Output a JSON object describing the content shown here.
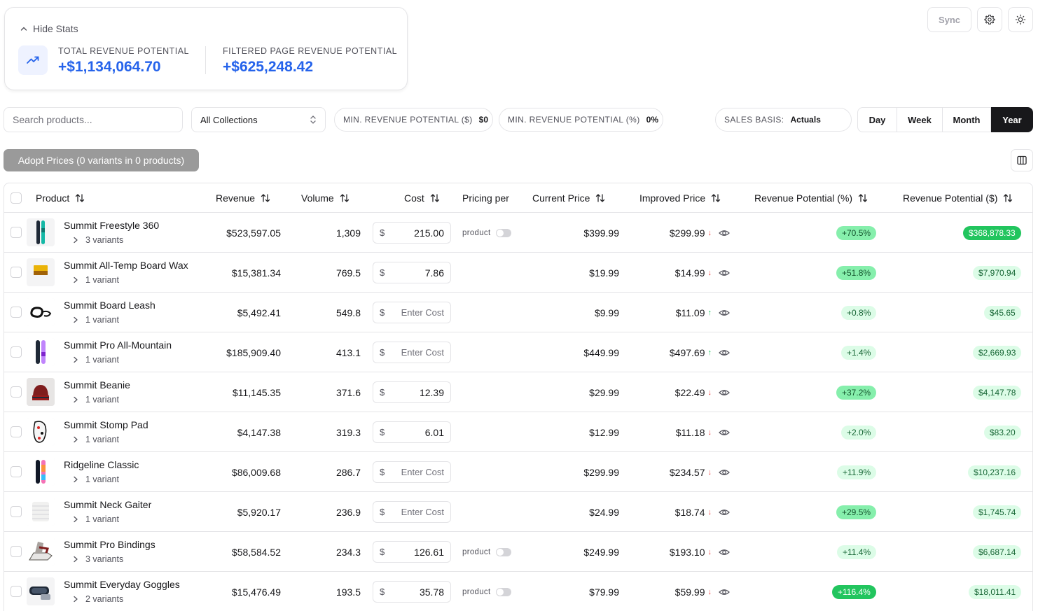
{
  "stats": {
    "toggle_label": "Hide Stats",
    "total_label": "TOTAL REVENUE POTENTIAL",
    "total_value": "+$1,134,064.70",
    "filtered_label": "FILTERED PAGE REVENUE POTENTIAL",
    "filtered_value": "+$625,248.42"
  },
  "toolbar": {
    "sync_label": "Sync",
    "settings_icon": "gear-icon",
    "theme_icon": "sun-icon"
  },
  "filters": {
    "search_placeholder": "Search products...",
    "collections_value": "All Collections",
    "min_rev_label": "MIN. REVENUE POTENTIAL ($)",
    "min_rev_value": "$0",
    "min_rev_pct_label": "MIN. REVENUE POTENTIAL (%)",
    "min_rev_pct_value": "0%",
    "sales_basis_label": "SALES BASIS:",
    "sales_basis_value": "Actuals",
    "periods": [
      "Day",
      "Week",
      "Month",
      "Year"
    ],
    "active_period": "Year"
  },
  "actions": {
    "adopt_label": "Adopt Prices (0 variants in 0 products)"
  },
  "table": {
    "headers": {
      "product": "Product",
      "revenue": "Revenue",
      "volume": "Volume",
      "cost": "Cost",
      "pricing_per": "Pricing per",
      "current_price": "Current Price",
      "improved_price": "Improved Price",
      "rev_pct": "Revenue Potential (%)",
      "rev_usd": "Revenue Potential ($)"
    },
    "cost_currency": "$",
    "cost_placeholder": "Enter Cost",
    "rows": [
      {
        "name": "Summit Freestyle 360",
        "variants": "3 variants",
        "revenue": "$523,597.05",
        "volume": "1,309",
        "cost": "215.00",
        "pricing_per": "product",
        "current": "$399.99",
        "improved": "$299.99",
        "dir": "↓",
        "pct": "+70.5%",
        "usd": "$368,878.33",
        "pct_level": 2,
        "usd_level": 3,
        "thumb": "board-teal"
      },
      {
        "name": "Summit All-Temp Board Wax",
        "variants": "1 variant",
        "revenue": "$15,381.34",
        "volume": "769.5",
        "cost": "7.86",
        "pricing_per": "",
        "current": "$19.99",
        "improved": "$14.99",
        "dir": "↓",
        "pct": "+51.8%",
        "usd": "$7,970.94",
        "pct_level": 2,
        "usd_level": 1,
        "thumb": "wax"
      },
      {
        "name": "Summit Board Leash",
        "variants": "1 variant",
        "revenue": "$5,492.41",
        "volume": "549.8",
        "cost": "",
        "pricing_per": "",
        "current": "$9.99",
        "improved": "$11.09",
        "dir": "↑",
        "pct": "+0.8%",
        "usd": "$45.65",
        "pct_level": 1,
        "usd_level": 1,
        "thumb": "leash"
      },
      {
        "name": "Summit Pro All-Mountain",
        "variants": "1 variant",
        "revenue": "$185,909.40",
        "volume": "413.1",
        "cost": "",
        "pricing_per": "",
        "current": "$449.99",
        "improved": "$497.69",
        "dir": "↑",
        "pct": "+1.4%",
        "usd": "$2,669.93",
        "pct_level": 1,
        "usd_level": 1,
        "thumb": "board-purple"
      },
      {
        "name": "Summit Beanie",
        "variants": "1 variant",
        "revenue": "$11,145.35",
        "volume": "371.6",
        "cost": "12.39",
        "pricing_per": "",
        "current": "$29.99",
        "improved": "$22.49",
        "dir": "↓",
        "pct": "+37.2%",
        "usd": "$4,147.78",
        "pct_level": 2,
        "usd_level": 1,
        "thumb": "beanie"
      },
      {
        "name": "Summit Stomp Pad",
        "variants": "1 variant",
        "revenue": "$4,147.38",
        "volume": "319.3",
        "cost": "6.01",
        "pricing_per": "",
        "current": "$12.99",
        "improved": "$11.18",
        "dir": "↓",
        "pct": "+2.0%",
        "usd": "$83.20",
        "pct_level": 1,
        "usd_level": 1,
        "thumb": "stomp"
      },
      {
        "name": "Ridgeline Classic",
        "variants": "1 variant",
        "revenue": "$86,009.68",
        "volume": "286.7",
        "cost": "",
        "pricing_per": "",
        "current": "$299.99",
        "improved": "$234.57",
        "dir": "↓",
        "pct": "+11.9%",
        "usd": "$10,237.16",
        "pct_level": 1,
        "usd_level": 1,
        "thumb": "board-pink"
      },
      {
        "name": "Summit Neck Gaiter",
        "variants": "1 variant",
        "revenue": "$5,920.17",
        "volume": "236.9",
        "cost": "",
        "pricing_per": "",
        "current": "$24.99",
        "improved": "$18.74",
        "dir": "↓",
        "pct": "+29.5%",
        "usd": "$1,745.74",
        "pct_level": 2,
        "usd_level": 1,
        "thumb": "gaiter"
      },
      {
        "name": "Summit Pro Bindings",
        "variants": "3 variants",
        "revenue": "$58,584.52",
        "volume": "234.3",
        "cost": "126.61",
        "pricing_per": "product",
        "current": "$249.99",
        "improved": "$193.10",
        "dir": "↓",
        "pct": "+11.4%",
        "usd": "$6,687.14",
        "pct_level": 1,
        "usd_level": 1,
        "thumb": "bindings"
      },
      {
        "name": "Summit Everyday Goggles",
        "variants": "2 variants",
        "revenue": "$15,476.49",
        "volume": "193.5",
        "cost": "35.78",
        "pricing_per": "product",
        "current": "$79.99",
        "improved": "$59.99",
        "dir": "↓",
        "pct": "+116.4%",
        "usd": "$18,011.41",
        "pct_level": 3,
        "usd_level": 1,
        "thumb": "goggles"
      }
    ]
  }
}
